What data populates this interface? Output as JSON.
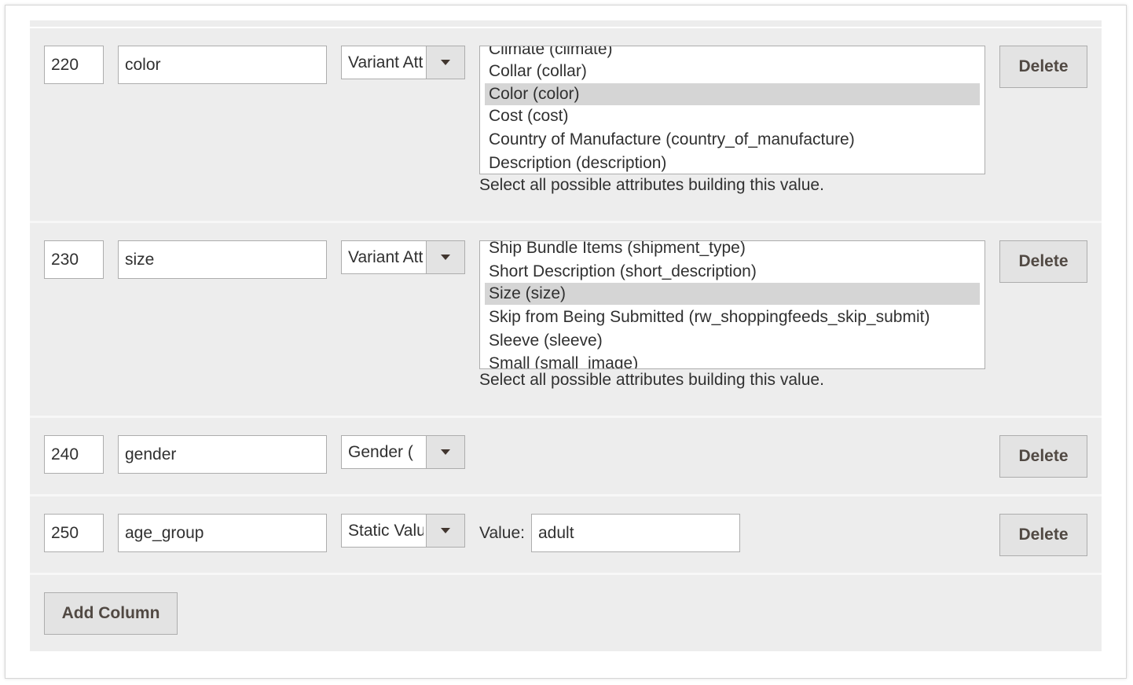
{
  "rows": [
    {
      "order": "220",
      "name": "color",
      "type": "Variant Attribute",
      "options": [
        "Climate (climate)",
        "Collar (collar)",
        "Color (color)",
        "Cost (cost)",
        "Country of Manufacture (country_of_manufacture)",
        "Description (description)"
      ],
      "selected_option": "Color (color)",
      "hint": "Select all possible attributes building this value.",
      "delete_label": "Delete"
    },
    {
      "order": "230",
      "name": "size",
      "type": "Variant Attribute",
      "options": [
        "Ship Bundle Items (shipment_type)",
        "Short Description (short_description)",
        "Size (size)",
        "Skip from Being Submitted (rw_shoppingfeeds_skip_submit)",
        "Sleeve (sleeve)",
        "Small (small_image)"
      ],
      "selected_option": "Size (size)",
      "hint": "Select all possible attributes building this value.",
      "delete_label": "Delete"
    },
    {
      "order": "240",
      "name": "gender",
      "type": "Gender (",
      "delete_label": "Delete"
    },
    {
      "order": "250",
      "name": "age_group",
      "type": "Static Value",
      "value_label": "Value:",
      "value": "adult",
      "delete_label": "Delete"
    }
  ],
  "add_column_label": "Add Column"
}
